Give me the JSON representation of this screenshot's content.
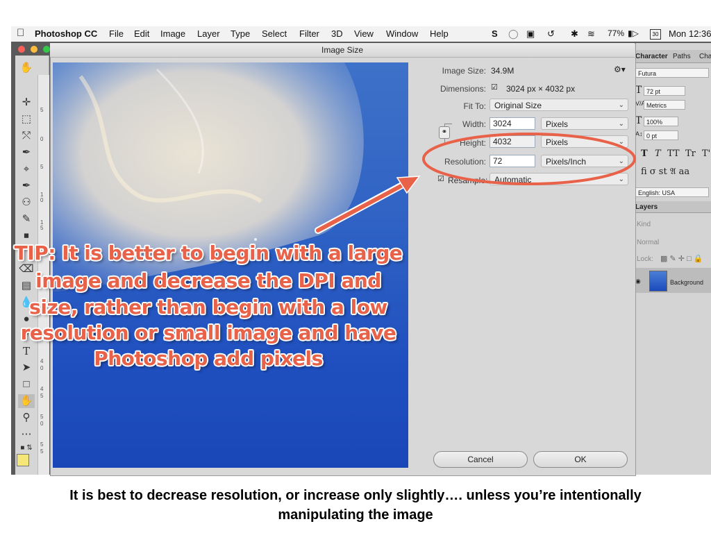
{
  "menubar": {
    "app_name": "Photoshop CC",
    "items": [
      "File",
      "Edit",
      "Image",
      "Layer",
      "Type",
      "Select",
      "Filter",
      "3D",
      "View",
      "Window",
      "Help"
    ],
    "battery": "77%",
    "calendar_day": "30",
    "clock": "Mon 12:36"
  },
  "dialog": {
    "title": "Image Size",
    "image_size_label": "Image Size:",
    "image_size_value": "34.9M",
    "dimensions_label": "Dimensions:",
    "dimensions_value": "3024 px  ×  4032 px",
    "fit_to_label": "Fit To:",
    "fit_to_value": "Original Size",
    "width_label": "Width:",
    "width_value": "3024",
    "width_unit": "Pixels",
    "height_label": "Height:",
    "height_value": "4032",
    "height_unit": "Pixels",
    "resolution_label": "Resolution:",
    "resolution_value": "72",
    "resolution_unit": "Pixels/Inch",
    "resample_label": "Resample:",
    "resample_value": "Automatic",
    "cancel_label": "Cancel",
    "ok_label": "OK"
  },
  "panels": {
    "tabs": [
      "Character",
      "Paths",
      "Cha"
    ],
    "font_family": "Futura",
    "font_size": "72 pt",
    "kerning": "Metrics",
    "scale": "100%",
    "baseline": "0 pt",
    "type_styles": [
      "T",
      "T",
      "TT",
      "Tr",
      "T'"
    ],
    "language": "English: USA",
    "layers_tab": "Layers",
    "kind_filter": "Kind",
    "blend_mode": "Normal",
    "lock_label": "Lock:",
    "layer_name": "Background"
  },
  "ruler_ticks": [
    "5",
    "0",
    "5",
    "1",
    "0",
    "1",
    "5",
    "4",
    "0",
    "4",
    "5",
    "5",
    "0",
    "5",
    "5"
  ],
  "tip_lines": [
    "TIP: It is better to begin with a large",
    "image and decrease the DPI and",
    "size, rather than begin with a low",
    "resolution or small image and have",
    "Photoshop add pixels"
  ],
  "caption_lines": [
    "It is best to decrease resolution, or increase only slightly…. unless you’re intentionally",
    "manipulating the image"
  ],
  "colors": {
    "annotation": "#e8624a",
    "canvas_blue": "#2f62c4",
    "dialog_bg": "#d8d8d8"
  }
}
